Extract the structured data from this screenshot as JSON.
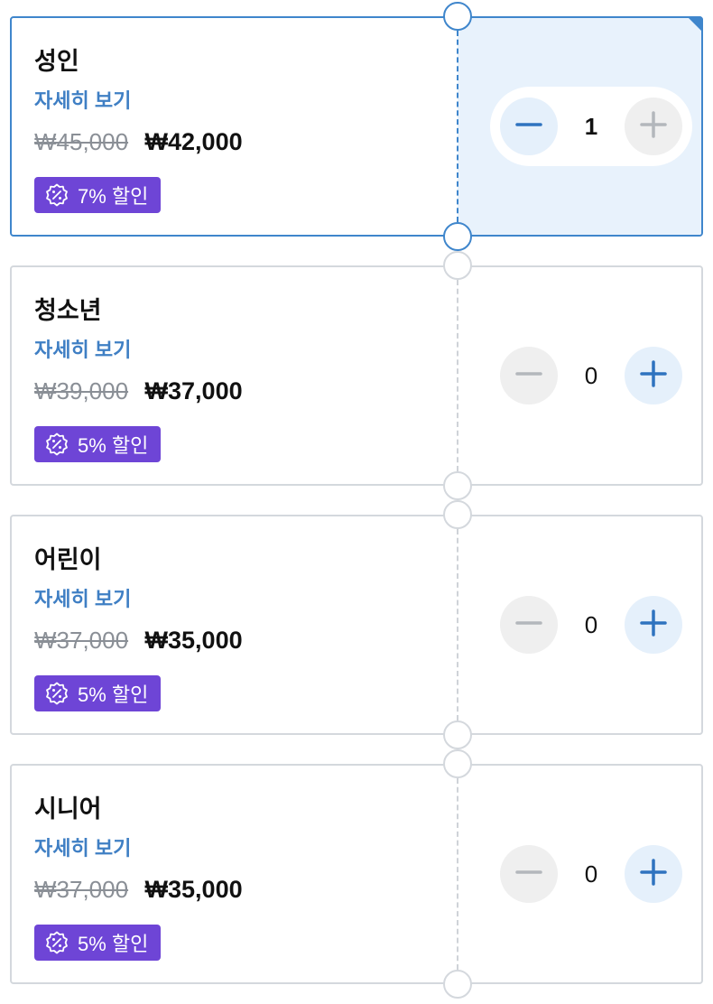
{
  "tickets": [
    {
      "title": "성인",
      "detail_link": "자세히 보기",
      "original_price": "₩45,000",
      "sale_price": "₩42,000",
      "discount_badge": "7% 할인",
      "quantity": "1",
      "selected": true
    },
    {
      "title": "청소년",
      "detail_link": "자세히 보기",
      "original_price": "₩39,000",
      "sale_price": "₩37,000",
      "discount_badge": "5% 할인",
      "quantity": "0",
      "selected": false
    },
    {
      "title": "어린이",
      "detail_link": "자세히 보기",
      "original_price": "₩37,000",
      "sale_price": "₩35,000",
      "discount_badge": "5% 할인",
      "quantity": "0",
      "selected": false
    },
    {
      "title": "시니어",
      "detail_link": "자세히 보기",
      "original_price": "₩37,000",
      "sale_price": "₩35,000",
      "discount_badge": "5% 할인",
      "quantity": "0",
      "selected": false
    }
  ],
  "colors": {
    "accent_blue": "#3f86cc",
    "selected_background": "#e8f2fc",
    "badge_purple": "#6e45d6",
    "disabled_gray": "#efefef"
  },
  "icons": {
    "discount": "discount-badge-icon",
    "decrement": "minus-icon",
    "increment": "plus-icon"
  }
}
